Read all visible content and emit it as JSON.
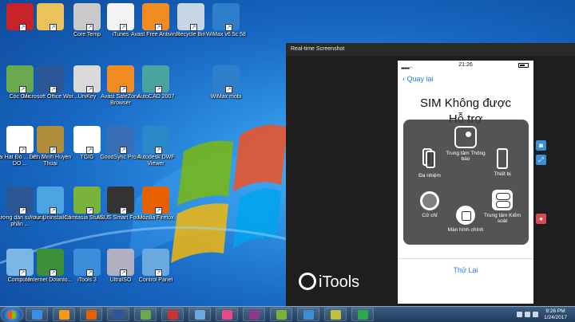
{
  "desktop": {
    "icons": [
      {
        "label": "",
        "name": "bookmark-app-icon",
        "color": "#c8222a"
      },
      {
        "label": "",
        "name": "folder-icon",
        "color": "#e9c25a"
      },
      {
        "label": "Core Temp",
        "name": "core-temp-icon",
        "color": "#c9c9c9"
      },
      {
        "label": "iTunes",
        "name": "itunes-icon",
        "color": "#f4f4f4"
      },
      {
        "label": "Avast Free Antivirus",
        "name": "avast-icon",
        "color": "#f28c22"
      },
      {
        "label": "Recycle Bin",
        "name": "recycle-bin-icon",
        "color": "#c6d6e4"
      },
      {
        "label": "WiMax v6.5c 58",
        "name": "wimax-icon",
        "color": "#2c7fc8"
      },
      {
        "label": "Cốc Cốc",
        "name": "coccoc-icon",
        "color": "#6aa84f"
      },
      {
        "label": "Microsoft Office Wor...",
        "name": "word-icon",
        "color": "#2b5797"
      },
      {
        "label": "UniKey",
        "name": "unikey-icon",
        "color": "#d9d9d9"
      },
      {
        "label": "Avast SafeZone Browser",
        "name": "safezone-icon",
        "color": "#f28c22"
      },
      {
        "label": "AutoCAD 2007",
        "name": "autocad-icon",
        "color": "#4ba3a0"
      },
      {
        "label": "WiMax mobi",
        "name": "wimax-mobi-icon",
        "color": "#2c7fc8"
      },
      {
        "label": "Bài Hát Đó ... 911, 1 DO ...",
        "name": "mp3-file-icon",
        "color": "#ffffff"
      },
      {
        "label": "Liên Minh Huyền Thoại",
        "name": "lol-icon",
        "color": "#b08d3a"
      },
      {
        "label": "TGIG",
        "name": "text-file-icon",
        "color": "#ffffff"
      },
      {
        "label": "GoodSync Pro 8",
        "name": "goodsync-icon",
        "color": "#3a6fb5"
      },
      {
        "label": "Autodesk DWF Viewer",
        "name": "dwf-viewer-icon",
        "color": "#2a88c8"
      },
      {
        "label": "Hướng dẫn sử dụng phần ...",
        "name": "word-doc-icon",
        "color": "#2b5797"
      },
      {
        "label": "Your Uninstaller!",
        "name": "uninstaller-icon",
        "color": "#4aa4e0"
      },
      {
        "label": "Camtasia Studio 7",
        "name": "camtasia-icon",
        "color": "#7ab33a"
      },
      {
        "label": "ASUS Smart Focus",
        "name": "asus-icon",
        "color": "#333333"
      },
      {
        "label": "Mozilla Firefox",
        "name": "firefox-icon",
        "color": "#e66000"
      },
      {
        "label": "Computer",
        "name": "computer-icon",
        "color": "#7ab6e6"
      },
      {
        "label": "Internet Downlo...",
        "name": "idm-icon",
        "color": "#3b8f3b"
      },
      {
        "label": "iTools 3",
        "name": "itools-icon",
        "color": "#3b8fd8"
      },
      {
        "label": "UltraISO",
        "name": "ultraiso-icon",
        "color": "#b0b0c0"
      },
      {
        "label": "Control Panel",
        "name": "control-panel-icon",
        "color": "#6aa8e0"
      }
    ]
  },
  "itools_window": {
    "title": "Real-time Screenshot",
    "logo_text": "iTools"
  },
  "phone": {
    "time": "21:26",
    "back_label": "Quay lại",
    "message_line1": "SIM Không được",
    "message_line2": "Hỗ trợ",
    "assistive_touch": {
      "notification_center": "Trung tâm Thông báo",
      "multitasking": "Đa nhiệm",
      "device": "Thiết bị",
      "gestures": "Cử chỉ",
      "home": "Màn hình chính",
      "control_center": "Trung tâm Kiểm soát"
    },
    "retry_label": "Thử Lại"
  },
  "taskbar": {
    "time": "9:26 PM",
    "date": "1/24/2017",
    "buttons": [
      {
        "name": "taskbar-ie-icon",
        "color": "#3a8ee6"
      },
      {
        "name": "taskbar-media-player-icon",
        "color": "#f39c12"
      },
      {
        "name": "taskbar-firefox-icon",
        "color": "#e66000"
      },
      {
        "name": "taskbar-word-icon",
        "color": "#2b5797"
      },
      {
        "name": "taskbar-coccoc-icon",
        "color": "#6aa84f"
      },
      {
        "name": "taskbar-unikey-icon",
        "color": "#cc3333"
      },
      {
        "name": "taskbar-control-panel-icon",
        "color": "#6aa8e0"
      },
      {
        "name": "taskbar-itunes-icon",
        "color": "#e94b8a"
      },
      {
        "name": "taskbar-winrar-icon",
        "color": "#8a3a8a"
      },
      {
        "name": "taskbar-camtasia-icon",
        "color": "#7ab33a"
      },
      {
        "name": "taskbar-itools-icon",
        "color": "#3b8fd8"
      },
      {
        "name": "taskbar-camtasia-recorder-icon",
        "color": "#c0c040"
      },
      {
        "name": "taskbar-green-app-icon",
        "color": "#2aa84a"
      }
    ]
  }
}
